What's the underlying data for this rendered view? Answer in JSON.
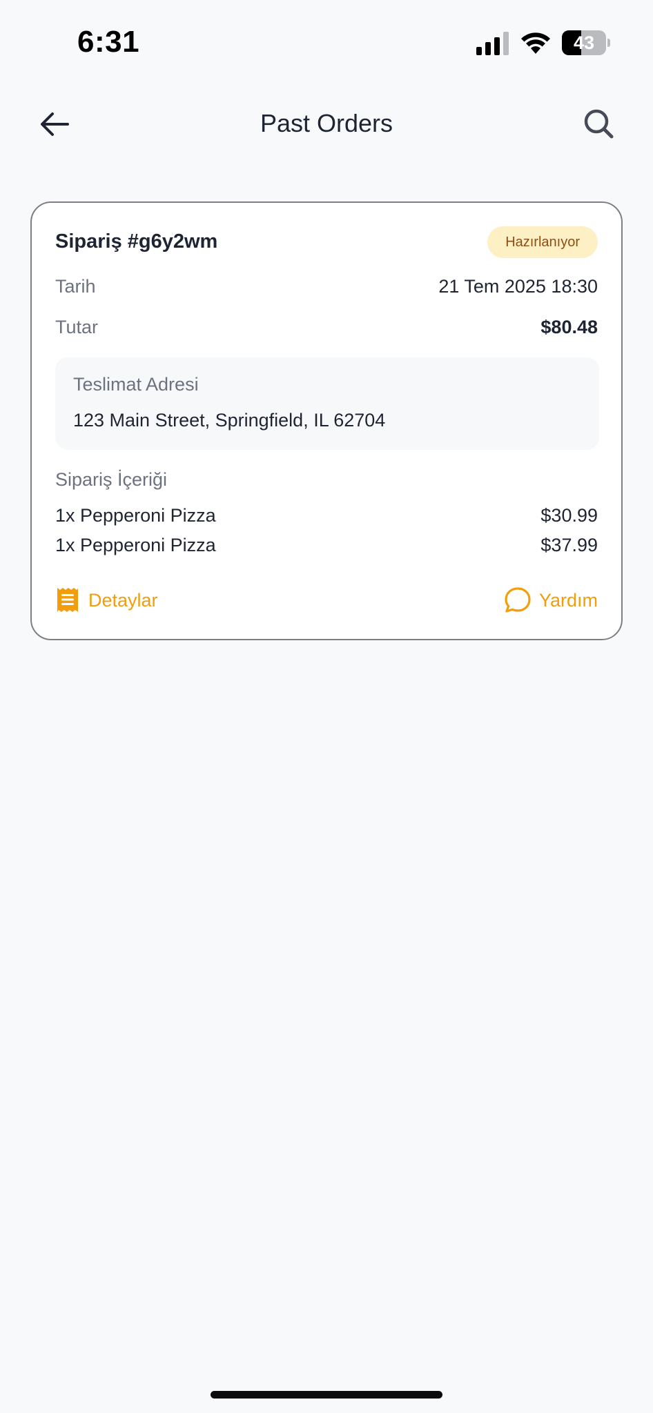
{
  "status_bar": {
    "time": "6:31",
    "battery_level": "43",
    "battery_fraction": 0.43,
    "icons": [
      "signal-icon",
      "wifi-icon",
      "battery-icon"
    ]
  },
  "header": {
    "title": "Past Orders",
    "back_icon": "arrow-left-icon",
    "search_icon": "search-icon"
  },
  "order": {
    "id_label": "Sipariş #g6y2wm",
    "status": "Hazırlanıyor",
    "date_label": "Tarih",
    "date_value": "21 Tem 2025 18:30",
    "total_label": "Tutar",
    "total_value": "$80.48",
    "address_label": "Teslimat Adresi",
    "address_value": "123 Main Street, Springfield, IL 62704",
    "items_label": "Sipariş İçeriği",
    "items": [
      {
        "name": "1x Pepperoni Pizza",
        "price": "$30.99"
      },
      {
        "name": "1x Pepperoni Pizza",
        "price": "$37.99"
      }
    ],
    "details_label": "Detaylar",
    "details_icon": "receipt-icon",
    "help_label": "Yardım",
    "help_icon": "chat-bubble-icon"
  },
  "colors": {
    "accent": "#f29e0c",
    "badge_bg": "#fdf0c4",
    "badge_text": "#8f4d10",
    "page_bg": "#f8f9fb",
    "text_primary": "#1f2433",
    "text_secondary": "#6c7280"
  }
}
